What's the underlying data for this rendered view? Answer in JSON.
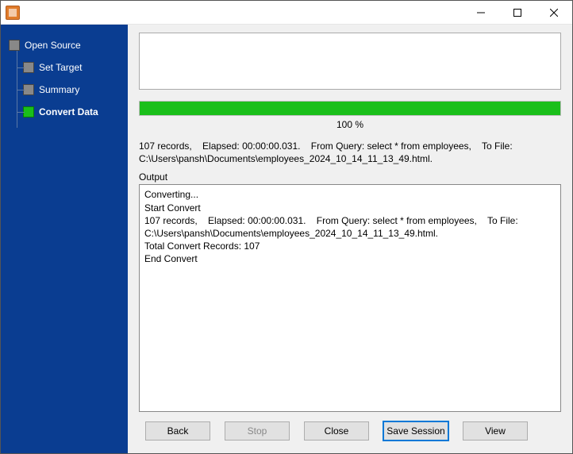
{
  "window": {
    "title": ""
  },
  "sidebar": {
    "items": [
      {
        "label": "Open Source",
        "active": false,
        "level": 0
      },
      {
        "label": "Set Target",
        "active": false,
        "level": 1
      },
      {
        "label": "Summary",
        "active": false,
        "level": 1
      },
      {
        "label": "Convert Data",
        "active": true,
        "level": 1
      }
    ]
  },
  "progress": {
    "percent_label": "100 %",
    "fill_percent": 100
  },
  "summary_text": "107 records,    Elapsed: 00:00:00.031.    From Query: select * from employees,    To File: C:\\Users\\pansh\\Documents\\employees_2024_10_14_11_13_49.html.",
  "output": {
    "label": "Output",
    "log": "Converting...\nStart Convert\n107 records,    Elapsed: 00:00:00.031.    From Query: select * from employees,    To File: C:\\Users\\pansh\\Documents\\employees_2024_10_14_11_13_49.html.\nTotal Convert Records: 107\nEnd Convert"
  },
  "buttons": {
    "back": "Back",
    "stop": "Stop",
    "close": "Close",
    "save_session": "Save Session",
    "view": "View"
  }
}
